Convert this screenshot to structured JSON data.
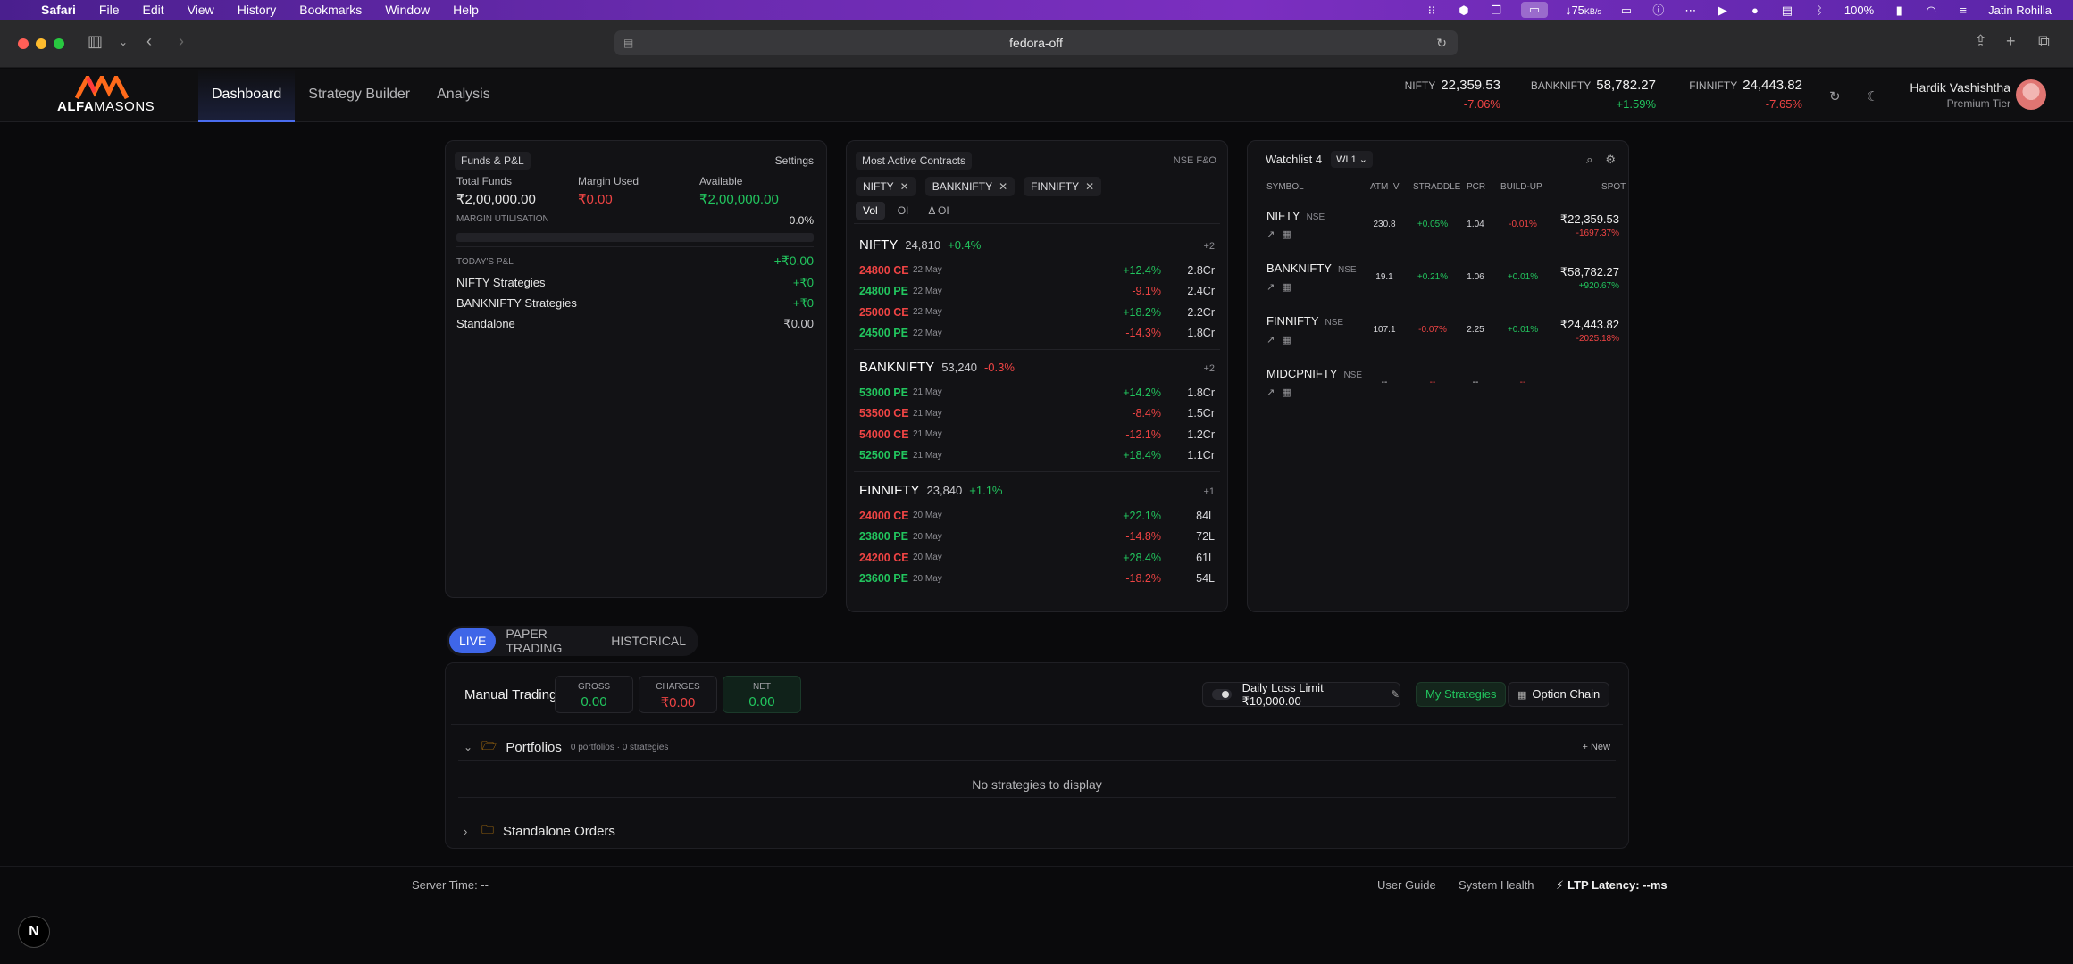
{
  "menubar": {
    "app": "Safari",
    "items": [
      "File",
      "Edit",
      "View",
      "History",
      "Bookmarks",
      "Window",
      "Help"
    ],
    "net_speed": "75",
    "net_unit": "KB/s",
    "battery": "100%",
    "user": "Jatin Rohilla"
  },
  "browser": {
    "url": "fedora-off"
  },
  "app": {
    "brand": {
      "word1": "ALFA",
      "word2": "MASONS"
    },
    "nav": [
      "Dashboard",
      "Strategy Builder",
      "Analysis"
    ],
    "tickers": [
      {
        "sym": "NIFTY",
        "price": "22,359.53",
        "chg": "-7.06%"
      },
      {
        "sym": "BANKNIFTY",
        "price": "58,782.27",
        "chg": "+1.59%"
      },
      {
        "sym": "FINNIFTY",
        "price": "24,443.82",
        "chg": "-7.65%"
      }
    ],
    "user": {
      "name": "Hardik Vashishtha",
      "tier": "Premium Tier"
    }
  },
  "funds": {
    "title": "Funds & P&L",
    "settings": "Settings",
    "total_label": "Total Funds",
    "total": "₹2,00,000.00",
    "margin_label": "Margin Used",
    "margin": "₹0.00",
    "avail_label": "Available",
    "avail": "₹2,00,000.00",
    "mu_label": "MARGIN UTILISATION",
    "mu_value": "0.0%",
    "mu_fraction": 0.0,
    "pl_label": "TODAY'S P&L",
    "pl_value": "+₹0.00",
    "rows": [
      {
        "label": "NIFTY Strategies",
        "value": "+₹0"
      },
      {
        "label": "BANKNIFTY Strategies",
        "value": "+₹0"
      },
      {
        "label": "Standalone",
        "value": "₹0.00"
      }
    ]
  },
  "most_active": {
    "title": "Most Active Contracts",
    "exchange": "NSE F&O",
    "chips": [
      "NIFTY",
      "BANKNIFTY",
      "FINNIFTY"
    ],
    "modes": [
      "Vol",
      "OI",
      "Δ OI"
    ],
    "groups": [
      {
        "name": "NIFTY",
        "price": "24,810",
        "chg": "+0.4%",
        "more": "+2",
        "rows": [
          {
            "c": "24800 CE",
            "d": "22 May",
            "p": "+12.4%",
            "v": "2.8Cr"
          },
          {
            "c": "24800 PE",
            "d": "22 May",
            "p": "-9.1%",
            "v": "2.4Cr"
          },
          {
            "c": "25000 CE",
            "d": "22 May",
            "p": "+18.2%",
            "v": "2.2Cr"
          },
          {
            "c": "24500 PE",
            "d": "22 May",
            "p": "-14.3%",
            "v": "1.8Cr"
          }
        ]
      },
      {
        "name": "BANKNIFTY",
        "price": "53,240",
        "chg": "-0.3%",
        "more": "+2",
        "rows": [
          {
            "c": "53000 PE",
            "d": "21 May",
            "p": "+14.2%",
            "v": "1.8Cr"
          },
          {
            "c": "53500 CE",
            "d": "21 May",
            "p": "-8.4%",
            "v": "1.5Cr"
          },
          {
            "c": "54000 CE",
            "d": "21 May",
            "p": "-12.1%",
            "v": "1.2Cr"
          },
          {
            "c": "52500 PE",
            "d": "21 May",
            "p": "+18.4%",
            "v": "1.1Cr"
          }
        ]
      },
      {
        "name": "FINNIFTY",
        "price": "23,840",
        "chg": "+1.1%",
        "more": "+1",
        "rows": [
          {
            "c": "24000 CE",
            "d": "20 May",
            "p": "+22.1%",
            "v": "84L"
          },
          {
            "c": "23800 PE",
            "d": "20 May",
            "p": "-14.8%",
            "v": "72L"
          },
          {
            "c": "24200 CE",
            "d": "20 May",
            "p": "+28.4%",
            "v": "61L"
          },
          {
            "c": "23600 PE",
            "d": "20 May",
            "p": "-18.2%",
            "v": "54L"
          }
        ]
      }
    ]
  },
  "watchlist": {
    "title": "Watchlist 4",
    "selector": "WL1",
    "cols": [
      "SYMBOL",
      "ATM IV",
      "STRADDLE",
      "PCR",
      "BUILD-UP",
      "SPOT"
    ],
    "rows": [
      {
        "sym": "NIFTY",
        "ex": "NSE",
        "iv": "230.8",
        "str": "+0.05%",
        "pcr": "1.04",
        "bu": "-0.01%",
        "spot": "₹22,359.53",
        "chg": "-1697.37%"
      },
      {
        "sym": "BANKNIFTY",
        "ex": "NSE",
        "iv": "19.1",
        "str": "+0.21%",
        "pcr": "1.06",
        "bu": "+0.01%",
        "spot": "₹58,782.27",
        "chg": "+920.67%"
      },
      {
        "sym": "FINNIFTY",
        "ex": "NSE",
        "iv": "107.1",
        "str": "-0.07%",
        "pcr": "2.25",
        "bu": "+0.01%",
        "spot": "₹24,443.82",
        "chg": "-2025.18%"
      },
      {
        "sym": "MIDCPNIFTY",
        "ex": "NSE",
        "iv": "--",
        "str": "--",
        "pcr": "--",
        "bu": "--",
        "spot": "—",
        "chg": ""
      }
    ]
  },
  "trading": {
    "modes": [
      "LIVE",
      "PAPER TRADING",
      "HISTORICAL"
    ],
    "title": "Manual Trading",
    "gross_label": "GROSS",
    "gross": "0.00",
    "charges_label": "CHARGES",
    "charges": "₹0.00",
    "net_label": "NET",
    "net": "0.00",
    "dll": "Daily Loss Limit ₹10,000.00",
    "my_strategies": "My Strategies",
    "option_chain": "Option Chain",
    "portfolios": "Portfolios",
    "portfolios_sub": "0 portfolios · 0 strategies",
    "new": "New",
    "empty": "No strategies to display",
    "standalone": "Standalone Orders"
  },
  "footer": {
    "server_time": "Server Time: --",
    "guide": "User Guide",
    "health": "System Health",
    "latency": "LTP Latency: --ms"
  },
  "colors": {
    "accent": "#3f66e8",
    "up": "#22c55e",
    "down": "#ef4444"
  }
}
